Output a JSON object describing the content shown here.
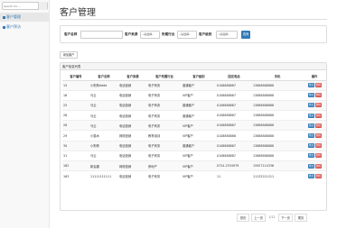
{
  "sidebar": {
    "search_placeholder": "Search for...",
    "items": [
      {
        "label": "客户管理"
      },
      {
        "label": "客户拜访"
      }
    ]
  },
  "page": {
    "title": "客户管理"
  },
  "search": {
    "name_label": "客户名称",
    "source_label": "客户来源",
    "source_value": "--请选择--",
    "industry_label": "所属行业",
    "industry_value": "--请选择--",
    "level_label": "客户级别",
    "level_value": "--请选择--",
    "button_label": "查询"
  },
  "toolbar": {
    "add_label": "添加客户"
  },
  "list": {
    "heading": "客户信息列表",
    "columns": [
      "客户编号",
      "客户名称",
      "客户来源",
      "客户所属行业",
      "客户级别",
      "固定电话",
      "手机",
      "操作"
    ],
    "rows": [
      [
        "15",
        "小狗狗dddd",
        "电话营销",
        "电子商务",
        "普通客户",
        "0108888887",
        "13888888888"
      ],
      [
        "16",
        "马云",
        "电话营销",
        "电子商务",
        "VIP客户",
        "0108888887",
        "13888888888"
      ],
      [
        "25",
        "马云",
        "电话营销",
        "电子商务",
        "普通客户",
        "0108888887",
        "13888888888"
      ],
      [
        "26",
        "马云",
        "电话营销",
        "电子商务",
        "普通客户",
        "0108888887",
        "13888888888"
      ],
      [
        "28",
        "马云",
        "电话营销",
        "电子商务",
        "VIP客户",
        "0108888887",
        "13888888888"
      ],
      [
        "29",
        "小猫木",
        "网络营销",
        "教育培训",
        "VIP客户",
        "0108888886",
        "13888888888"
      ],
      [
        "30",
        "小狗狗",
        "电话营销",
        "电子商务",
        "普通客户",
        "0108888887",
        "13888888888"
      ],
      [
        "31",
        "马云",
        "电话营销",
        "电子商务",
        "VIP客户",
        "0108888887",
        "13888888888"
      ],
      [
        "162",
        "新会翻",
        "网络营销",
        "房地产",
        "VIP客户",
        "0724-2334979",
        "15927114336"
      ],
      [
        "163",
        "11111111111",
        "电话营销",
        "电子商务",
        "VIP客户",
        "11",
        "11132211211"
      ]
    ],
    "edit_label": "修改",
    "delete_label": "删除"
  },
  "pagination": {
    "first": "首页",
    "prev": "上一页",
    "info": "1/12",
    "next": "下一页",
    "last": "尾页"
  }
}
